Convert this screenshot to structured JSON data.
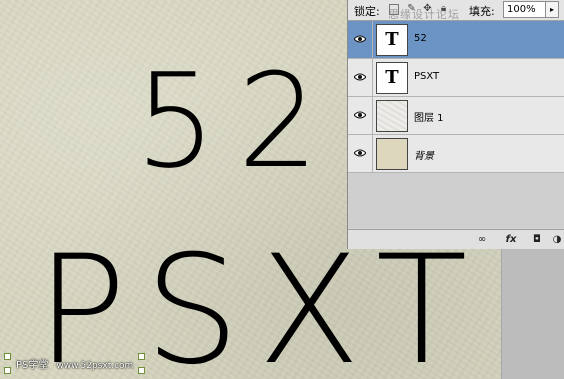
{
  "canvas": {
    "line1": "52",
    "line2": "PSXT",
    "watermark": {
      "brand": "PS学堂",
      "site": "www.52psxt.com"
    }
  },
  "layers_panel": {
    "lock_label": "锁定:",
    "fill_label": "填充:",
    "fill_value": "100%",
    "fill_arrow": "▸",
    "forum_watermark": "思缘设计论坛",
    "layers": [
      {
        "name": "52",
        "type": "text",
        "thumb_glyph": "T",
        "visible": true,
        "selected": true
      },
      {
        "name": "PSXT",
        "type": "text",
        "thumb_glyph": "T",
        "visible": true,
        "selected": false
      },
      {
        "name": "图层 1",
        "type": "paper",
        "visible": true,
        "selected": false
      },
      {
        "name": "背景",
        "type": "background",
        "visible": true,
        "selected": false,
        "locked": true
      }
    ],
    "bottom_buttons": {
      "link": "∞",
      "fx": "fx",
      "mask": "◘",
      "adjust": "◑"
    }
  },
  "colors": {
    "selected_row": "#6b94c4",
    "canvas_paper": "#d7d6c0"
  }
}
